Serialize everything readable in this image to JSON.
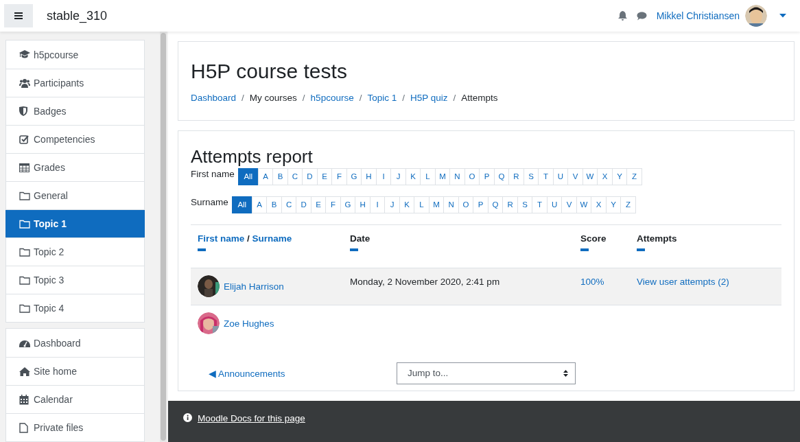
{
  "header": {
    "site_name": "stable_310",
    "user_name": "Mikkel Christiansen"
  },
  "sidebar": {
    "groups": [
      [
        {
          "label": "h5pcourse",
          "kind": "cap",
          "selected": false
        },
        {
          "label": "Participants",
          "kind": "users",
          "selected": false
        },
        {
          "label": "Badges",
          "kind": "shield",
          "selected": false
        },
        {
          "label": "Competencies",
          "kind": "check",
          "selected": false
        },
        {
          "label": "Grades",
          "kind": "table",
          "selected": false
        },
        {
          "label": "General",
          "kind": "folder",
          "selected": false
        },
        {
          "label": "Topic 1",
          "kind": "folder",
          "selected": true
        },
        {
          "label": "Topic 2",
          "kind": "folder",
          "selected": false
        },
        {
          "label": "Topic 3",
          "kind": "folder",
          "selected": false
        },
        {
          "label": "Topic 4",
          "kind": "folder",
          "selected": false
        }
      ],
      [
        {
          "label": "Dashboard",
          "kind": "gauge",
          "selected": false
        },
        {
          "label": "Site home",
          "kind": "home",
          "selected": false
        },
        {
          "label": "Calendar",
          "kind": "calendar",
          "selected": false
        },
        {
          "label": "Private files",
          "kind": "file",
          "selected": false
        }
      ]
    ]
  },
  "page": {
    "title": "H5P course tests",
    "breadcrumbs": [
      {
        "label": "Dashboard",
        "kind": "link"
      },
      {
        "label": "/",
        "kind": "separator"
      },
      {
        "label": "My courses",
        "kind": "text"
      },
      {
        "label": "/",
        "kind": "separator"
      },
      {
        "label": "h5pcourse",
        "kind": "link"
      },
      {
        "label": "/",
        "kind": "separator"
      },
      {
        "label": "Topic 1",
        "kind": "link"
      },
      {
        "label": "/",
        "kind": "separator"
      },
      {
        "label": "H5P quiz",
        "kind": "link"
      },
      {
        "label": "/",
        "kind": "separator"
      },
      {
        "label": "Attempts",
        "kind": "text"
      }
    ]
  },
  "report": {
    "title": "Attempts report",
    "filters": [
      {
        "label": "First name",
        "letters": [
          {
            "label": "All",
            "selected": true
          },
          {
            "label": "A",
            "selected": false
          },
          {
            "label": "B",
            "selected": false
          },
          {
            "label": "C",
            "selected": false
          },
          {
            "label": "D",
            "selected": false
          },
          {
            "label": "E",
            "selected": false
          },
          {
            "label": "F",
            "selected": false
          },
          {
            "label": "G",
            "selected": false
          },
          {
            "label": "H",
            "selected": false
          },
          {
            "label": "I",
            "selected": false
          },
          {
            "label": "J",
            "selected": false
          },
          {
            "label": "K",
            "selected": false
          },
          {
            "label": "L",
            "selected": false
          },
          {
            "label": "M",
            "selected": false
          },
          {
            "label": "N",
            "selected": false
          },
          {
            "label": "O",
            "selected": false
          },
          {
            "label": "P",
            "selected": false
          },
          {
            "label": "Q",
            "selected": false
          },
          {
            "label": "R",
            "selected": false
          },
          {
            "label": "S",
            "selected": false
          },
          {
            "label": "T",
            "selected": false
          },
          {
            "label": "U",
            "selected": false
          },
          {
            "label": "V",
            "selected": false
          },
          {
            "label": "W",
            "selected": false
          },
          {
            "label": "X",
            "selected": false
          },
          {
            "label": "Y",
            "selected": false
          },
          {
            "label": "Z",
            "selected": false
          }
        ]
      },
      {
        "label": "Surname",
        "letters": [
          {
            "label": "All",
            "selected": true
          },
          {
            "label": "A",
            "selected": false
          },
          {
            "label": "B",
            "selected": false
          },
          {
            "label": "C",
            "selected": false
          },
          {
            "label": "D",
            "selected": false
          },
          {
            "label": "E",
            "selected": false
          },
          {
            "label": "F",
            "selected": false
          },
          {
            "label": "G",
            "selected": false
          },
          {
            "label": "H",
            "selected": false
          },
          {
            "label": "I",
            "selected": false
          },
          {
            "label": "J",
            "selected": false
          },
          {
            "label": "K",
            "selected": false
          },
          {
            "label": "L",
            "selected": false
          },
          {
            "label": "M",
            "selected": false
          },
          {
            "label": "N",
            "selected": false
          },
          {
            "label": "O",
            "selected": false
          },
          {
            "label": "P",
            "selected": false
          },
          {
            "label": "Q",
            "selected": false
          },
          {
            "label": "R",
            "selected": false
          },
          {
            "label": "S",
            "selected": false
          },
          {
            "label": "T",
            "selected": false
          },
          {
            "label": "U",
            "selected": false
          },
          {
            "label": "V",
            "selected": false
          },
          {
            "label": "W",
            "selected": false
          },
          {
            "label": "X",
            "selected": false
          },
          {
            "label": "Y",
            "selected": false
          },
          {
            "label": "Z",
            "selected": false
          }
        ]
      }
    ],
    "columns": [
      {
        "parts": [
          {
            "text": "First name",
            "kind": "link"
          },
          {
            "text": "/",
            "kind": "text"
          },
          {
            "text": "Surname",
            "kind": "link"
          }
        ]
      },
      {
        "parts": [
          {
            "text": "Date",
            "kind": "text"
          }
        ]
      },
      {
        "parts": [
          {
            "text": "Score",
            "kind": "text"
          }
        ]
      },
      {
        "parts": [
          {
            "text": "Attempts",
            "kind": "text"
          }
        ]
      }
    ],
    "rows": [
      {
        "name": "Elijah Harrison",
        "date": "Monday, 2 November 2020, 2:41 pm",
        "score": "100%",
        "attempts": "View user attempts (2)",
        "selected": true
      },
      {
        "name": "Zoe Hughes",
        "selected": false
      }
    ],
    "previous": "◀ Announcements",
    "jump": "Jump to..."
  },
  "footer": {
    "docs_link": "Moodle Docs for this page"
  }
}
